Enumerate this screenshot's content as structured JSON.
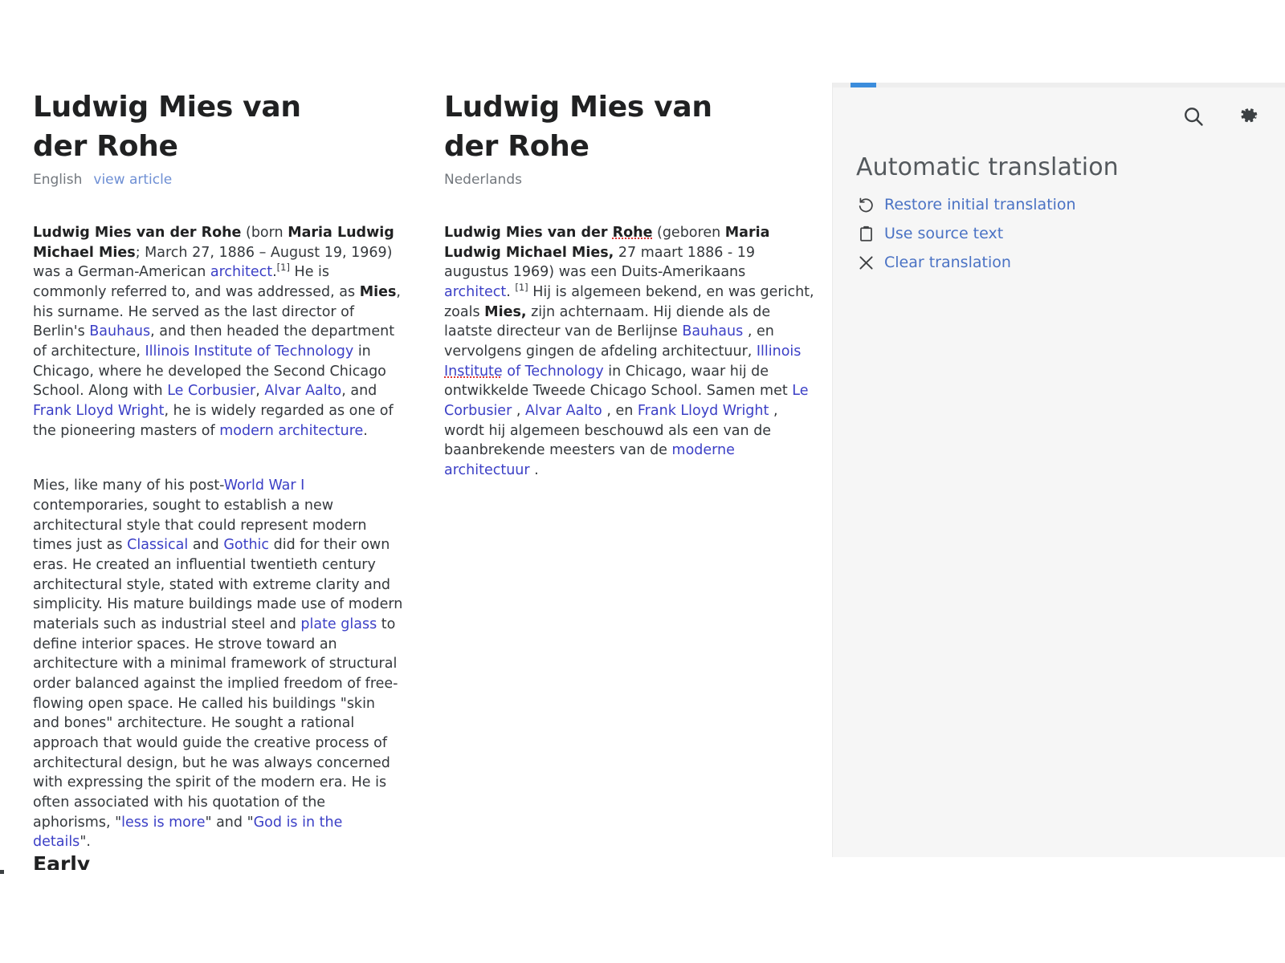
{
  "source_article": {
    "title": "Ludwig Mies van der Rohe",
    "language": "English",
    "view_article_label": "view article",
    "paragraph1": {
      "bold_name": "Ludwig Mies van der Rohe",
      "t1": " (born ",
      "bold_birth_name": "Maria Ludwig Michael Mies",
      "t2": "; March 27, 1886 – August 19, 1969) was a German-American ",
      "link_architect": "architect",
      "t3": ".",
      "ref1": "[1]",
      "t4": " He is commonly referred to, and was addressed, as ",
      "bold_mies": "Mies",
      "t5": ", his surname. He served as the last director of Berlin's ",
      "link_bauhaus": "Bauhaus",
      "t6": ", and then headed the department of architecture, ",
      "link_iit": "Illinois Institute of Technology",
      "t7": " in Chicago, where he developed the Second Chicago School. Along with ",
      "link_corbusier": "Le Corbusier",
      "t8": ", ",
      "link_aalto": "Alvar Aalto",
      "t9": ", and ",
      "link_wright": "Frank Lloyd Wright",
      "t10": ", he is widely regarded as one of the pioneering masters of ",
      "link_modern_arch": "modern architecture",
      "t11": "."
    },
    "paragraph2": {
      "t1": "Mies, like many of his post-",
      "link_ww1": "World War I",
      "t2": " contemporaries, sought to establish a new architectural style that could represent modern times just as ",
      "link_classical": "Classical",
      "t3": " and ",
      "link_gothic": "Gothic",
      "t4": " did for their own eras. He created an influential twentieth century architectural style, stated with extreme clarity and simplicity. His mature buildings made use of modern materials such as industrial steel and ",
      "link_plate_glass": "plate glass",
      "t5": " to define interior spaces. He strove toward an architecture with a minimal framework of structural order balanced against the implied freedom of free-flowing open space. He called his buildings \"skin and bones\" architecture. He sought a rational approach that would guide the creative process of architectural design, but he was always concerned with expressing the spirit of the modern era. He is often associated with his quotation of the aphorisms, \"",
      "link_less_is_more": "less is more",
      "t6": "\" and \"",
      "link_god_details": "God is in the details",
      "t7": "\"."
    },
    "next_section_heading": "Early"
  },
  "target_article": {
    "title": "Ludwig Mies van der Rohe",
    "language": "Nederlands",
    "paragraph1": {
      "bold_name_a": "Ludwig Mies van der ",
      "bold_name_misspelled": "Rohe",
      "t1": " (geboren ",
      "bold_birth_name": "Maria Ludwig Michael Mies,",
      "t2": " 27 maart 1886 - 19 augustus 1969) was een Duits-Amerikaans ",
      "link_architect": "architect",
      "t3": ". ",
      "ref1": "[1]",
      "t4": " Hij is algemeen bekend, en was gericht, zoals ",
      "bold_mies": "Mies,",
      "t5": " zijn achternaam. Hij diende als de laatste directeur van de Berlijnse ",
      "link_bauhaus": "Bauhaus",
      "t6": " , en vervolgens gingen de afdeling architectuur, ",
      "link_iit_a": "Illinois ",
      "link_iit_misspelled": "Institute",
      "link_iit_b": " of Technology",
      "t7": " in Chicago, waar hij de ontwikkelde Tweede Chicago School. Samen met ",
      "link_corbusier": "Le Corbusier",
      "t8": " , ",
      "link_aalto": "Alvar Aalto",
      "t9": " , en ",
      "link_wright": "Frank Lloyd Wright",
      "t10": " , wordt hij algemeen beschouwd als een van de baanbrekende meesters van de ",
      "link_modern_arch": "moderne architectuur",
      "t11": " ."
    }
  },
  "translation_panel": {
    "title": "Automatic translation",
    "search_icon": "search-icon",
    "settings_icon": "gear-icon",
    "actions": [
      {
        "icon": "undo-icon",
        "label": "Restore initial translation"
      },
      {
        "icon": "clipboard-icon",
        "label": "Use source text"
      },
      {
        "icon": "close-icon",
        "label": "Clear translation"
      }
    ]
  },
  "colors": {
    "link_blue": "#3b3fc6",
    "action_blue": "#4a72c4",
    "accent_blue": "#3c8ddc",
    "panel_bg": "#f6f6f6",
    "spellcheck_red": "#dd3333",
    "muted_text": "#72777d"
  }
}
